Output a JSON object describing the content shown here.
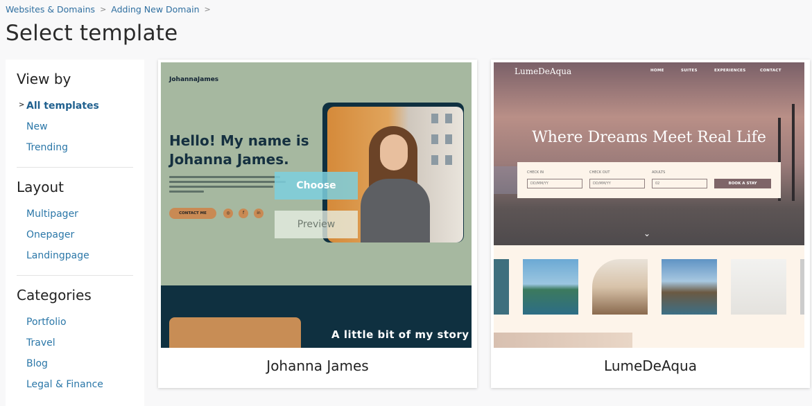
{
  "breadcrumb": {
    "items": [
      "Websites & Domains",
      "Adding New Domain"
    ],
    "sep": ">"
  },
  "page": {
    "title": "Select template"
  },
  "sidebar": {
    "view_by": {
      "heading": "View by",
      "items": [
        "All templates",
        "New",
        "Trending"
      ],
      "active": "All templates"
    },
    "layout": {
      "heading": "Layout",
      "items": [
        "Multipager",
        "Onepager",
        "Landingpage"
      ]
    },
    "categories": {
      "heading": "Categories",
      "items": [
        "Portfolio",
        "Travel",
        "Blog",
        "Legal & Finance"
      ]
    }
  },
  "templates": [
    {
      "name": "Johanna James",
      "preview": {
        "logo": "JohannaJames",
        "headline": "Hello! My name is Johanna James.",
        "cta": "CONTACT ME",
        "social": [
          "◎",
          "f",
          "in"
        ],
        "story": "A little bit of my story"
      },
      "actions": {
        "choose": "Choose",
        "preview": "Preview"
      }
    },
    {
      "name": "LumeDeAqua",
      "preview": {
        "logo": "LumeDeAqua",
        "nav": [
          "HOME",
          "SUITES",
          "EXPERIENCES",
          "CONTACT"
        ],
        "tagline": "Where Dreams Meet Real Life",
        "form": {
          "check_in_label": "CHECK IN",
          "check_in_placeholder": "DD/MM/YY",
          "check_out_label": "CHECK OUT",
          "check_out_placeholder": "DD/MM/YY",
          "adults_label": "ADULTS",
          "adults_value": "02",
          "book_label": "BOOK A STAY"
        },
        "arrow": "⌄"
      }
    }
  ],
  "colors": {
    "link": "#2b77a8",
    "choose_button": "#7ccfde",
    "jj_bg": "#a6b8a0",
    "jj_dark": "#0f3040",
    "lume_cream": "#fdf4ea"
  }
}
